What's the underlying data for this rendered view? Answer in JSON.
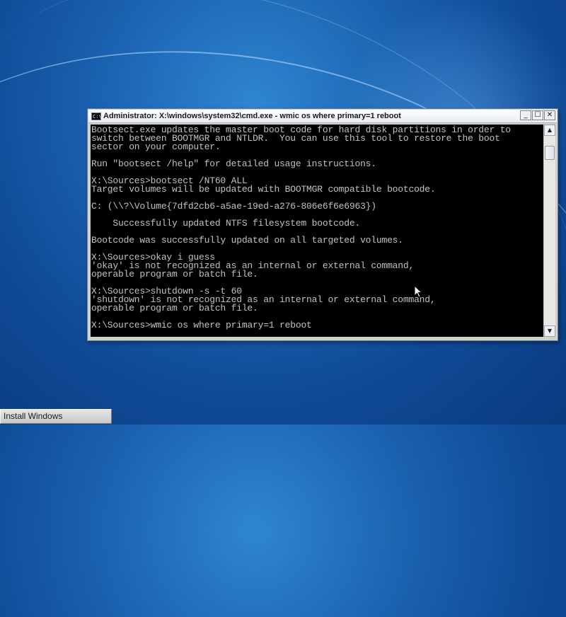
{
  "window": {
    "title": "Administrator: X:\\windows\\system32\\cmd.exe - wmic  os where primary=1 reboot",
    "icon_text": "C:\\",
    "minimize": "_",
    "maximize": "☐",
    "close": "✕"
  },
  "console": {
    "lines": [
      "Bootsect.exe updates the master boot code for hard disk partitions in order to",
      "switch between BOOTMGR and NTLDR.  You can use this tool to restore the boot",
      "sector on your computer.",
      "",
      "Run \"bootsect /help\" for detailed usage instructions.",
      "",
      "X:\\Sources>bootsect /NT60 ALL",
      "Target volumes will be updated with BOOTMGR compatible bootcode.",
      "",
      "C: (\\\\?\\Volume{7dfd2cb6-a5ae-19ed-a276-806e6f6e6963})",
      "",
      "    Successfully updated NTFS filesystem bootcode.",
      "",
      "Bootcode was successfully updated on all targeted volumes.",
      "",
      "X:\\Sources>okay i guess",
      "'okay' is not recognized as an internal or external command,",
      "operable program or batch file.",
      "",
      "X:\\Sources>shutdown -s -t 60",
      "'shutdown' is not recognized as an internal or external command,",
      "operable program or batch file.",
      "",
      "X:\\Sources>wmic os where primary=1 reboot"
    ]
  },
  "scrollbar": {
    "up": "▲",
    "down": "▼"
  },
  "taskbar": {
    "install_label": "Install Windows"
  },
  "colors": {
    "desktop": "#1b62b0",
    "console_bg": "#000000",
    "console_fg": "#c0c0c0"
  }
}
